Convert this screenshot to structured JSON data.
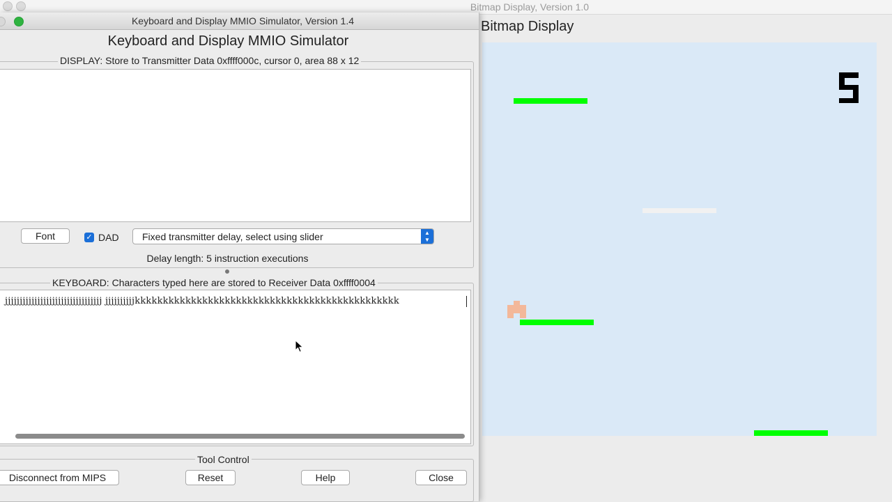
{
  "bitmap_window": {
    "title": "Bitmap Display, Version 1.0",
    "heading": "Bitmap Display",
    "score": "5",
    "colors": {
      "background": "#dae9f7",
      "platform": "#00ff00",
      "platform_faded": "#f1f1f1",
      "player": "#f3b89a",
      "score": "#000000"
    }
  },
  "mmio_window": {
    "title": "Keyboard and Display MMIO Simulator, Version 1.4",
    "heading": "Keyboard and Display MMIO Simulator",
    "display_legend": "DISPLAY: Store to Transmitter Data 0xffff000c, cursor 0, area 88 x 12",
    "font_button": "Font",
    "dad_label": "DAD",
    "dad_checked": true,
    "delay_select_value": "Fixed transmitter delay, select using slider",
    "delay_length": "Delay length: 5 instruction executions",
    "keyboard_legend": "KEYBOARD: Characters typed here are stored to Receiver Data 0xffff0004",
    "keyboard_text": "jjjjjjjjjjjjjjjjjjjjjjjjjjjjjjjjj jjjjjjjjjjkkkkkkkkkkkkkkkkkkkkkkkkkkkkkkkkkkkkkkkkkkkkkkk",
    "tool_control_legend": "Tool Control",
    "buttons": {
      "disconnect": "Disconnect from MIPS",
      "reset": "Reset",
      "help": "Help",
      "close": "Close"
    }
  }
}
